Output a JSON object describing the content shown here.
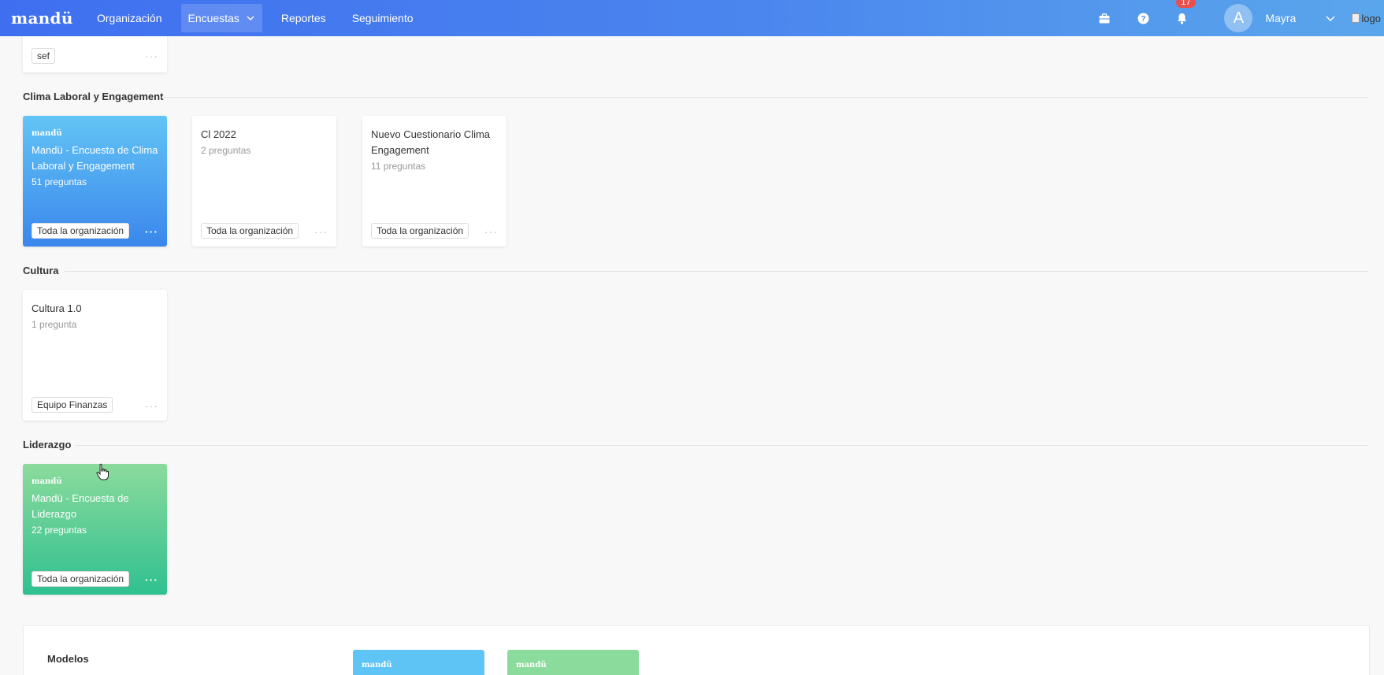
{
  "header": {
    "brand": "mandü",
    "nav": [
      {
        "label": "Organización"
      },
      {
        "label": "Encuestas"
      },
      {
        "label": "Reportes"
      },
      {
        "label": "Seguimiento"
      }
    ],
    "notifications_count": "17",
    "avatar_letter": "A",
    "user_name": "Mayra",
    "logo_alt": "logo"
  },
  "top_card": {
    "tag": "sef",
    "more": "···"
  },
  "sections": [
    {
      "title": "Clima Laboral y Engagement",
      "cards": [
        {
          "brand": "mandü",
          "title": "Mandü - Encuesta de Clima Laboral y Engagement",
          "subtitle": "51 preguntas",
          "tag": "Toda la organización",
          "more": "···"
        },
        {
          "title": "Cl 2022",
          "subtitle": "2 preguntas",
          "tag": "Toda la organización",
          "more": "···"
        },
        {
          "title": "Nuevo Cuestionario Clima Engagement",
          "subtitle": "11 preguntas",
          "tag": "Toda la organización",
          "more": "···"
        }
      ]
    },
    {
      "title": "Cultura",
      "cards": [
        {
          "title": "Cultura 1.0",
          "subtitle": "1 pregunta",
          "tag": "Equipo Finanzas",
          "more": "···"
        }
      ]
    },
    {
      "title": "Liderazgo",
      "cards": [
        {
          "brand": "mandü",
          "title": "Mandü - Encuesta de Liderazgo",
          "subtitle": "22 preguntas",
          "tag": "Toda la organización",
          "more": "···"
        }
      ]
    }
  ],
  "models": {
    "title": "Modelos",
    "cards": [
      {
        "brand": "mandü"
      },
      {
        "brand": "mandü"
      }
    ]
  },
  "colors": {
    "nav_start": "#3f6ff0",
    "nav_end": "#5aa6ec",
    "badge": "#ea4f4f",
    "card_blue": "#3a86ec",
    "card_green": "#30c090"
  }
}
